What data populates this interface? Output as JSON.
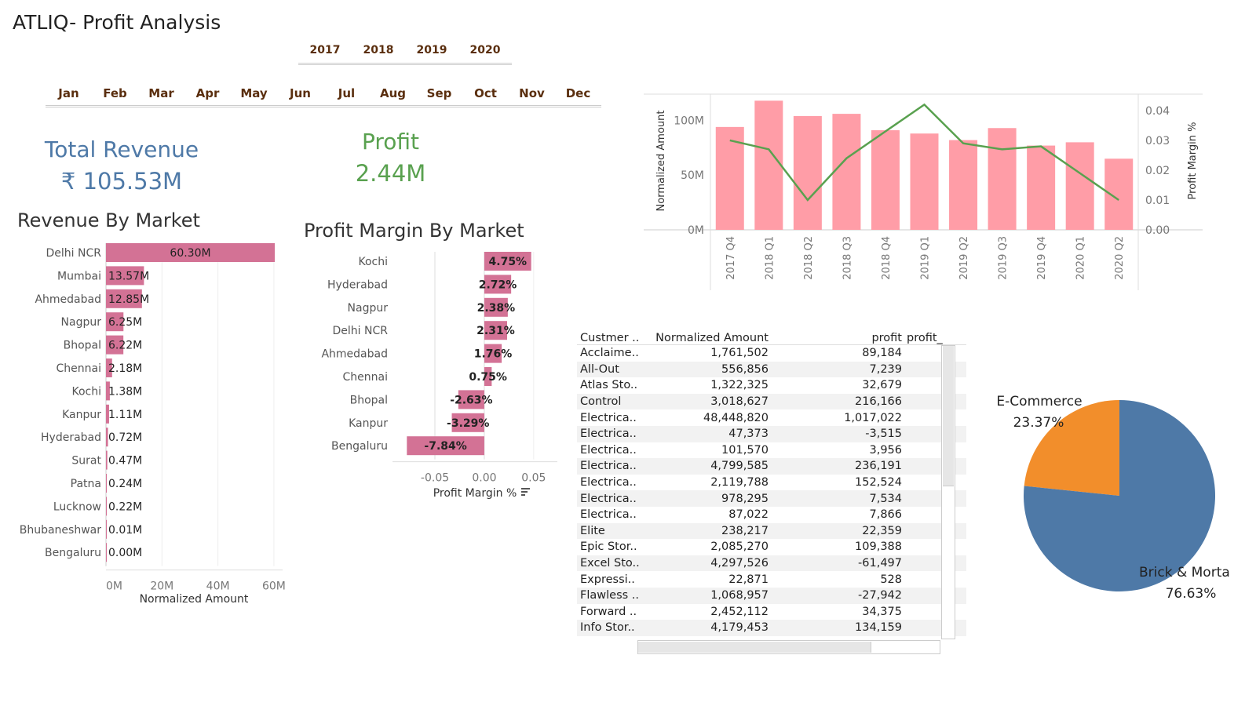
{
  "dashboard": {
    "title": "ATLIQ- Profit Analysis",
    "years": [
      "2017",
      "2018",
      "2019",
      "2020"
    ],
    "months": [
      "Jan",
      "Feb",
      "Mar",
      "Apr",
      "May",
      "Jun",
      "Jul",
      "Aug",
      "Sep",
      "Oct",
      "Nov",
      "Dec"
    ]
  },
  "kpis": {
    "revenue_label": "Total Revenue",
    "revenue_value": "₹ 105.53M",
    "profit_label": "Profit",
    "profit_value": "2.44M",
    "colors": {
      "revenue": "#4e79a7",
      "profit": "#59a14f"
    }
  },
  "chart_data": [
    {
      "id": "revenue_by_market",
      "type": "bar",
      "orientation": "horizontal",
      "title": "Revenue By Market",
      "xlabel": "Normalized Amount",
      "categories": [
        "Delhi NCR",
        "Mumbai",
        "Ahmedabad",
        "Nagpur",
        "Bhopal",
        "Chennai",
        "Kochi",
        "Kanpur",
        "Hyderabad",
        "Surat",
        "Patna",
        "Lucknow",
        "Bhubaneshwar",
        "Bengaluru"
      ],
      "values": [
        60.3,
        13.57,
        12.85,
        6.25,
        6.22,
        2.18,
        1.38,
        1.11,
        0.72,
        0.47,
        0.24,
        0.22,
        0.01,
        0.0
      ],
      "labels": [
        "60.30M",
        "13.57M",
        "12.85M",
        "6.25M",
        "6.22M",
        "2.18M",
        "1.38M",
        "1.11M",
        "0.72M",
        "0.47M",
        "0.24M",
        "0.22M",
        "0.01M",
        "0.00M"
      ],
      "xticks": [
        "0M",
        "20M",
        "40M",
        "60M"
      ],
      "xtick_values": [
        0,
        20,
        40,
        60
      ],
      "xlim": [
        0,
        60.3
      ],
      "color": "#d37295"
    },
    {
      "id": "profit_margin_by_market",
      "type": "bar",
      "orientation": "horizontal",
      "title": "Profit Margin By Market",
      "xlabel": "Profit Margin %",
      "categories": [
        "Kochi",
        "Hyderabad",
        "Nagpur",
        "Delhi NCR",
        "Ahmedabad",
        "Chennai",
        "Bhopal",
        "Kanpur",
        "Bengaluru"
      ],
      "values": [
        0.0475,
        0.0272,
        0.0238,
        0.0231,
        0.0176,
        0.0075,
        -0.0263,
        -0.0329,
        -0.0784
      ],
      "labels": [
        "4.75%",
        "2.72%",
        "2.38%",
        "2.31%",
        "1.76%",
        "0.75%",
        "-2.63%",
        "-3.29%",
        "-7.84%"
      ],
      "xticks": [
        "-0.05",
        "0.00",
        "0.05"
      ],
      "xtick_values": [
        -0.05,
        0,
        0.05
      ],
      "xlim": [
        -0.085,
        0.07
      ],
      "color": "#d37295"
    },
    {
      "id": "quarterly_trend",
      "type": "bar",
      "combo": "bar+line dual axis",
      "categories": [
        "2017 Q4",
        "2018 Q1",
        "2018 Q2",
        "2018 Q3",
        "2018 Q4",
        "2019 Q1",
        "2019 Q2",
        "2019 Q3",
        "2019 Q4",
        "2020 Q1",
        "2020 Q2"
      ],
      "series": [
        {
          "name": "Normalized Amount",
          "type": "bar",
          "axis": "left",
          "values": [
            94,
            118,
            104,
            106,
            91,
            88,
            82,
            93,
            77,
            80,
            65
          ]
        },
        {
          "name": "Profit Margin %",
          "type": "line",
          "axis": "right",
          "values": [
            0.03,
            0.027,
            0.01,
            0.024,
            0.033,
            0.042,
            0.029,
            0.027,
            0.028,
            0.019,
            0.01
          ]
        }
      ],
      "ylabel": "Normalized Amount",
      "y2label": "Profit Margin %",
      "yticks": [
        "0M",
        "50M",
        "100M"
      ],
      "ytick_values": [
        0,
        50,
        100
      ],
      "ylim": [
        0,
        124
      ],
      "y2ticks": [
        "0.00",
        "0.01",
        "0.02",
        "0.03",
        "0.04"
      ],
      "y2tick_values": [
        0,
        0.01,
        0.02,
        0.03,
        0.04
      ],
      "y2lim": [
        0,
        0.0455
      ],
      "colors": {
        "bar": "#ff9da7",
        "line": "#59a14f"
      }
    },
    {
      "id": "customer_table",
      "type": "table",
      "columns": [
        "Custmer ..",
        "Normalized Amount",
        "profit",
        "profit_"
      ],
      "rows": [
        [
          "Acclaime..",
          "1,761,502",
          "89,184"
        ],
        [
          "All-Out",
          "556,856",
          "7,239"
        ],
        [
          "Atlas Sto..",
          "1,322,325",
          "32,679"
        ],
        [
          "Control",
          "3,018,627",
          "216,166"
        ],
        [
          "Electrica..",
          "48,448,820",
          "1,017,022"
        ],
        [
          "Electrica..",
          "47,373",
          "-3,515"
        ],
        [
          "Electrica..",
          "101,570",
          "3,956"
        ],
        [
          "Electrica..",
          "4,799,585",
          "236,191"
        ],
        [
          "Electrica..",
          "2,119,788",
          "152,524"
        ],
        [
          "Electrica..",
          "978,295",
          "7,534"
        ],
        [
          "Electrica..",
          "87,022",
          "7,866"
        ],
        [
          "Elite",
          "238,217",
          "22,359"
        ],
        [
          "Epic Stor..",
          "2,085,270",
          "109,388"
        ],
        [
          "Excel Sto..",
          "4,297,526",
          "-61,497"
        ],
        [
          "Expressi..",
          "22,871",
          "528"
        ],
        [
          "Flawless ..",
          "1,068,957",
          "-27,942"
        ],
        [
          "Forward ..",
          "2,452,112",
          "34,375"
        ],
        [
          "Info Stor..",
          "4,179,453",
          "134,159"
        ]
      ]
    },
    {
      "id": "channel_share",
      "type": "pie",
      "categories": [
        "E-Commerce",
        "Brick & Morta"
      ],
      "values": [
        23.37,
        76.63
      ],
      "labels": [
        "23.37%",
        "76.63%"
      ],
      "colors": [
        "#f28e2b",
        "#4e79a7"
      ]
    }
  ]
}
